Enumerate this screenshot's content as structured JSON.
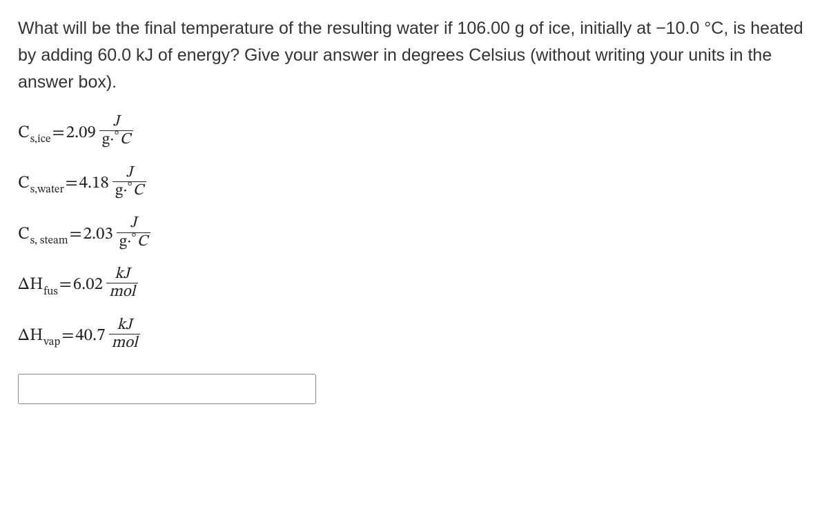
{
  "question": "What will be the final temperature of the resulting water if 106.00 g of ice, initially at −10.0 °C, is heated by adding 60.0 kJ of energy? Give your answer in degrees Celsius (without writing your units in the answer box).",
  "constants": {
    "cs_ice": {
      "symbol_main": "C",
      "symbol_sub": "s,ice",
      "eq": "=",
      "value": "2.09",
      "unit_num": "J",
      "unit_den": "g·°C"
    },
    "cs_water": {
      "symbol_main": "C",
      "symbol_sub": "s,water",
      "eq": "=",
      "value": "4.18",
      "unit_num": "J",
      "unit_den": "g·°C"
    },
    "cs_steam": {
      "symbol_main": "C",
      "symbol_sub": "s, steam",
      "eq": "=",
      "value": "2.03",
      "unit_num": "J",
      "unit_den": "g·°C"
    },
    "dh_fus": {
      "symbol_main": "ΔH",
      "symbol_sub": "fus",
      "eq": "=",
      "value": "6.02",
      "unit_num": "kJ",
      "unit_den": "mol"
    },
    "dh_vap": {
      "symbol_main": "ΔH",
      "symbol_sub": "vap",
      "eq": "=",
      "value": "40.7",
      "unit_num": "kJ",
      "unit_den": "mol"
    }
  },
  "answer": {
    "value": ""
  }
}
